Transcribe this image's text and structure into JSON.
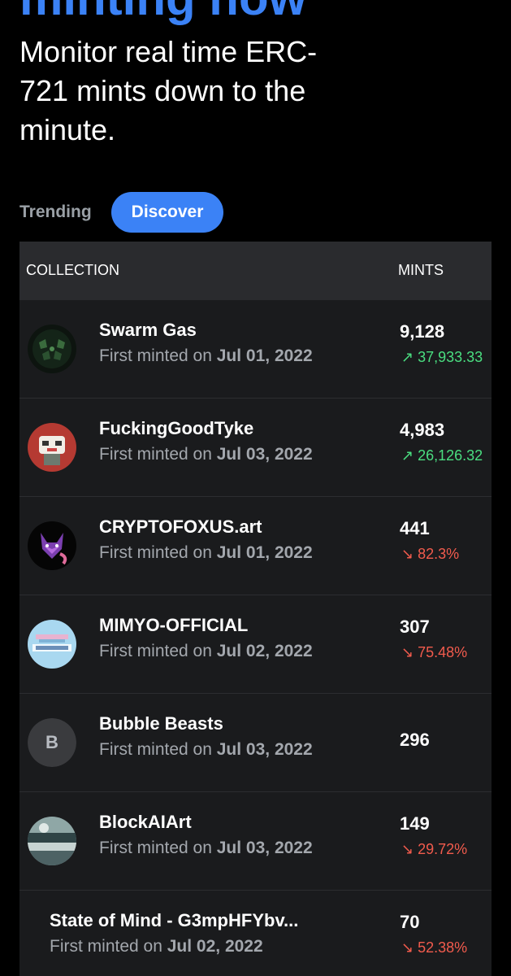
{
  "hero": {
    "heading_fragment": "minting now",
    "subtitle": "Monitor real time ERC-721 mints down to the minute."
  },
  "tabs": [
    {
      "label": "Trending",
      "active": false
    },
    {
      "label": "Discover",
      "active": true
    }
  ],
  "table": {
    "headers": {
      "collection": "COLLECTION",
      "mints": "MINTS"
    },
    "first_minted_prefix": "First minted on",
    "rows": [
      {
        "name": "Swarm Gas",
        "date": "Jul 01, 2022",
        "mints": "9,128",
        "change": "37,933.33",
        "trend": "up",
        "avatar": "swarm-gas-avatar"
      },
      {
        "name": "FuckingGoodTyke",
        "date": "Jul 03, 2022",
        "mints": "4,983",
        "change": "26,126.32",
        "trend": "up",
        "avatar": "tyke-avatar"
      },
      {
        "name": "CRYPTOFOXUS.art",
        "date": "Jul 01, 2022",
        "mints": "441",
        "change": "82.3%",
        "trend": "down",
        "avatar": "fox-avatar"
      },
      {
        "name": "MIMYO-OFFICIAL",
        "date": "Jul 02, 2022",
        "mints": "307",
        "change": "75.48%",
        "trend": "down",
        "avatar": "mimyo-avatar"
      },
      {
        "name": "Bubble Beasts",
        "date": "Jul 03, 2022",
        "mints": "296",
        "change": "",
        "trend": "none",
        "avatar": "letter-avatar",
        "avatar_letter": "B"
      },
      {
        "name": "BlockAIArt",
        "date": "Jul 03, 2022",
        "mints": "149",
        "change": "29.72%",
        "trend": "down",
        "avatar": "blockai-avatar"
      },
      {
        "name": "State of Mind - G3mpHFYbv...",
        "date": "Jul 02, 2022",
        "mints": "70",
        "change": "52.38%",
        "trend": "down",
        "avatar": "none"
      }
    ]
  },
  "colors": {
    "accent": "#3b82f6",
    "up": "#4ade80",
    "down": "#f15b4d",
    "header_bg": "#2a2b2e",
    "row_bg": "#1a1b1d"
  },
  "icons": {
    "up": "arrow-up-right-icon",
    "down": "arrow-down-right-icon"
  }
}
